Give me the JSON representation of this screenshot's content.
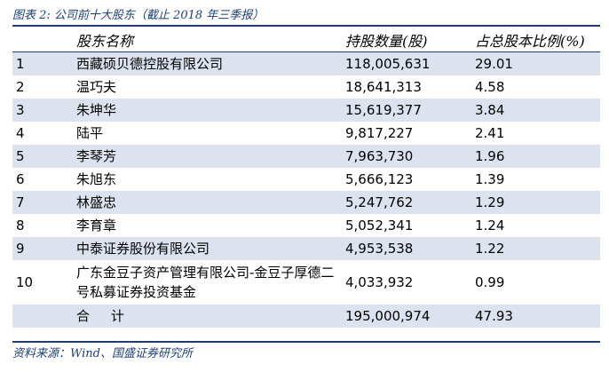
{
  "caption": "图表 2:  公司前十大股东（截止 2018 年三季报）",
  "headers": {
    "rank": "",
    "name": "股东名称",
    "shares": "持股数量(股)",
    "ratio": "占总股本比例(%)"
  },
  "rows": [
    {
      "rank": "1",
      "name": "西藏硕贝德控股有限公司",
      "shares": "118,005,631",
      "ratio": "29.01"
    },
    {
      "rank": "2",
      "name": "温巧夫",
      "shares": "18,641,313",
      "ratio": "4.58"
    },
    {
      "rank": "3",
      "name": "朱坤华",
      "shares": "15,619,377",
      "ratio": "3.84"
    },
    {
      "rank": "4",
      "name": "陆平",
      "shares": "9,817,227",
      "ratio": "2.41"
    },
    {
      "rank": "5",
      "name": "李琴芳",
      "shares": "7,963,730",
      "ratio": "1.96"
    },
    {
      "rank": "6",
      "name": "朱旭东",
      "shares": "5,666,123",
      "ratio": "1.39"
    },
    {
      "rank": "7",
      "name": "林盛忠",
      "shares": "5,247,762",
      "ratio": "1.29"
    },
    {
      "rank": "8",
      "name": "李育章",
      "shares": "5,052,341",
      "ratio": "1.24"
    },
    {
      "rank": "9",
      "name": "中泰证券股份有限公司",
      "shares": "4,953,538",
      "ratio": "1.22"
    },
    {
      "rank": "10",
      "name": "广东金豆子资产管理有限公司-金豆子厚德二号私募证券投资基金",
      "shares": "4,033,932",
      "ratio": "0.99"
    }
  ],
  "total": {
    "label": "合     计",
    "shares": "195,000,974",
    "ratio": "47.93"
  },
  "source": "资料来源：Wind、国盛证券研究所",
  "colors": {
    "accent": "#1f3f74",
    "stripe": "#dde3ee"
  }
}
